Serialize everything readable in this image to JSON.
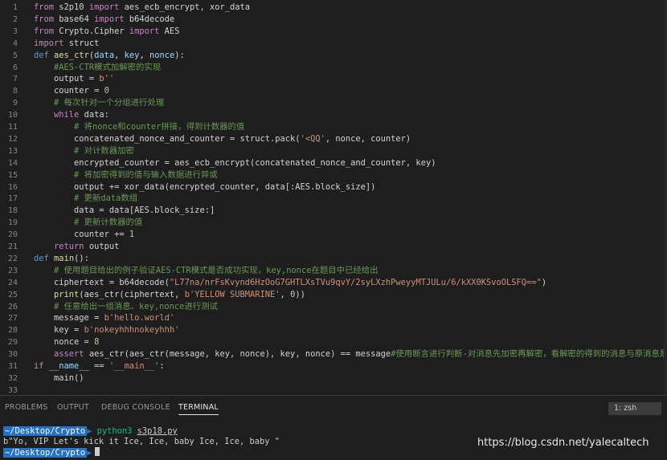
{
  "editor": {
    "lines": [
      {
        "n": "1",
        "t": [
          [
            "kw",
            "from"
          ],
          [
            "tx",
            " s2p10 "
          ],
          [
            "kw",
            "import"
          ],
          [
            "tx",
            " aes_ecb_encrypt, xor_data"
          ]
        ]
      },
      {
        "n": "2",
        "t": [
          [
            "kw",
            "from"
          ],
          [
            "tx",
            " base64 "
          ],
          [
            "kw",
            "import"
          ],
          [
            "tx",
            " b64decode"
          ]
        ]
      },
      {
        "n": "3",
        "t": [
          [
            "kw",
            "from"
          ],
          [
            "tx",
            " Crypto.Cipher "
          ],
          [
            "kw",
            "import"
          ],
          [
            "tx",
            " AES"
          ]
        ]
      },
      {
        "n": "4",
        "t": [
          [
            "kw",
            "import"
          ],
          [
            "tx",
            " struct"
          ]
        ]
      },
      {
        "n": "5",
        "t": [
          [
            "kw2",
            "def"
          ],
          [
            "tx",
            " "
          ],
          [
            "fn",
            "aes_ctr"
          ],
          [
            "tx",
            "("
          ],
          [
            "var",
            "data"
          ],
          [
            "tx",
            ", "
          ],
          [
            "var",
            "key"
          ],
          [
            "tx",
            ", "
          ],
          [
            "var",
            "nonce"
          ],
          [
            "tx",
            "):"
          ]
        ]
      },
      {
        "n": "6",
        "t": [
          [
            "tx",
            "    "
          ],
          [
            "cm",
            "#AES-CTR模式加解密的实现"
          ]
        ]
      },
      {
        "n": "7",
        "t": [
          [
            "tx",
            "    output = "
          ],
          [
            "str",
            "b''"
          ]
        ]
      },
      {
        "n": "8",
        "t": [
          [
            "tx",
            "    counter = "
          ],
          [
            "num",
            "0"
          ]
        ]
      },
      {
        "n": "9",
        "t": [
          [
            "tx",
            "    "
          ],
          [
            "cm",
            "# 每次针对一个分组进行处理"
          ]
        ]
      },
      {
        "n": "10",
        "t": [
          [
            "tx",
            "    "
          ],
          [
            "kw",
            "while"
          ],
          [
            "tx",
            " data:"
          ]
        ]
      },
      {
        "n": "11",
        "t": [
          [
            "tx",
            "        "
          ],
          [
            "cm",
            "# 将nonce和counter拼接，得到计数器的值"
          ]
        ]
      },
      {
        "n": "12",
        "t": [
          [
            "tx",
            "        concatenated_nonce_and_counter = struct.pack("
          ],
          [
            "str",
            "'<QQ'"
          ],
          [
            "tx",
            ", nonce, counter)"
          ]
        ]
      },
      {
        "n": "13",
        "t": [
          [
            "tx",
            "        "
          ],
          [
            "cm",
            "# 对计数器加密"
          ]
        ]
      },
      {
        "n": "14",
        "t": [
          [
            "tx",
            "        encrypted_counter = aes_ecb_encrypt(concatenated_nonce_and_counter, key)"
          ]
        ]
      },
      {
        "n": "15",
        "t": [
          [
            "tx",
            "        "
          ],
          [
            "cm",
            "# 将加密得到的值与输入数据进行异或"
          ]
        ]
      },
      {
        "n": "16",
        "t": [
          [
            "tx",
            "        output += xor_data(encrypted_counter, data[:AES.block_size])"
          ]
        ]
      },
      {
        "n": "17",
        "t": [
          [
            "tx",
            "        "
          ],
          [
            "cm",
            "# 更新data数组"
          ]
        ]
      },
      {
        "n": "18",
        "t": [
          [
            "tx",
            "        data = data[AES.block_size:]"
          ]
        ]
      },
      {
        "n": "19",
        "t": [
          [
            "tx",
            "        "
          ],
          [
            "cm",
            "# 更新计数器的值"
          ]
        ]
      },
      {
        "n": "20",
        "t": [
          [
            "tx",
            "        counter += "
          ],
          [
            "num",
            "1"
          ]
        ]
      },
      {
        "n": "21",
        "t": [
          [
            "tx",
            "    "
          ],
          [
            "kw",
            "return"
          ],
          [
            "tx",
            " output"
          ]
        ]
      },
      {
        "n": "22",
        "t": [
          [
            "kw2",
            "def"
          ],
          [
            "tx",
            " "
          ],
          [
            "fn",
            "main"
          ],
          [
            "tx",
            "():"
          ]
        ]
      },
      {
        "n": "23",
        "t": [
          [
            "tx",
            "    "
          ],
          [
            "cm",
            "# 使用题目给出的例子验证AES-CTR模式是否成功实现，key,nonce在题目中已经给出"
          ]
        ]
      },
      {
        "n": "24",
        "t": [
          [
            "tx",
            "    ciphertext = b64decode("
          ],
          [
            "str",
            "\"L77na/nrFsKvynd6HzOoG7GHTLXsTVu9qvY/2syLXzhPweyyMTJULu/6/kXX0KSvoOLSFQ==\""
          ],
          [
            "tx",
            ")"
          ]
        ]
      },
      {
        "n": "25",
        "t": [
          [
            "tx",
            "    "
          ],
          [
            "fn",
            "print"
          ],
          [
            "tx",
            "(aes_ctr(ciphertext, "
          ],
          [
            "str",
            "b'YELLOW SUBMARINE'"
          ],
          [
            "tx",
            ", "
          ],
          [
            "num",
            "0"
          ],
          [
            "tx",
            "))"
          ]
        ]
      },
      {
        "n": "26",
        "t": [
          [
            "tx",
            "    "
          ],
          [
            "cm",
            "# 任意给出一组消息、key,nonce进行测试"
          ]
        ]
      },
      {
        "n": "27",
        "t": [
          [
            "tx",
            "    message = "
          ],
          [
            "str",
            "b'hello.world'"
          ]
        ]
      },
      {
        "n": "28",
        "t": [
          [
            "tx",
            "    key = "
          ],
          [
            "str",
            "b'nokeyhhhnokeyhhh'"
          ]
        ]
      },
      {
        "n": "29",
        "t": [
          [
            "tx",
            "    nonce = "
          ],
          [
            "num",
            "8"
          ]
        ]
      },
      {
        "n": "30",
        "t": [
          [
            "tx",
            "    "
          ],
          [
            "kw",
            "assert"
          ],
          [
            "tx",
            " aes_ctr(aes_ctr(message, key, nonce), key, nonce) == message"
          ],
          [
            "cm",
            "#使用断言进行判断-对消息先加密再解密，看解密的得到的消息与原消息是否相符"
          ]
        ]
      },
      {
        "n": "31",
        "t": [
          [
            "kw",
            "if"
          ],
          [
            "tx",
            " "
          ],
          [
            "var",
            "__name__"
          ],
          [
            "tx",
            " == "
          ],
          [
            "str",
            "'__main__'"
          ],
          [
            "tx",
            ":"
          ]
        ]
      },
      {
        "n": "32",
        "t": [
          [
            "tx",
            "    main()"
          ]
        ]
      },
      {
        "n": "33",
        "t": []
      }
    ]
  },
  "panel": {
    "tabs": [
      "PROBLEMS",
      "OUTPUT",
      "DEBUG CONSOLE",
      "TERMINAL"
    ],
    "active_tab": "TERMINAL",
    "shell": "1: zsh",
    "terminal": {
      "prompt1": "~/Desktop/Crypto",
      "command": "python3",
      "argument": "s3p18.py",
      "output": "b\"Yo, VIP Let's kick it Ice, Ice, baby Ice, Ice, baby \"",
      "prompt2": "~/Desktop/Crypto"
    }
  },
  "watermark": "https://blog.csdn.net/yalecaltech"
}
